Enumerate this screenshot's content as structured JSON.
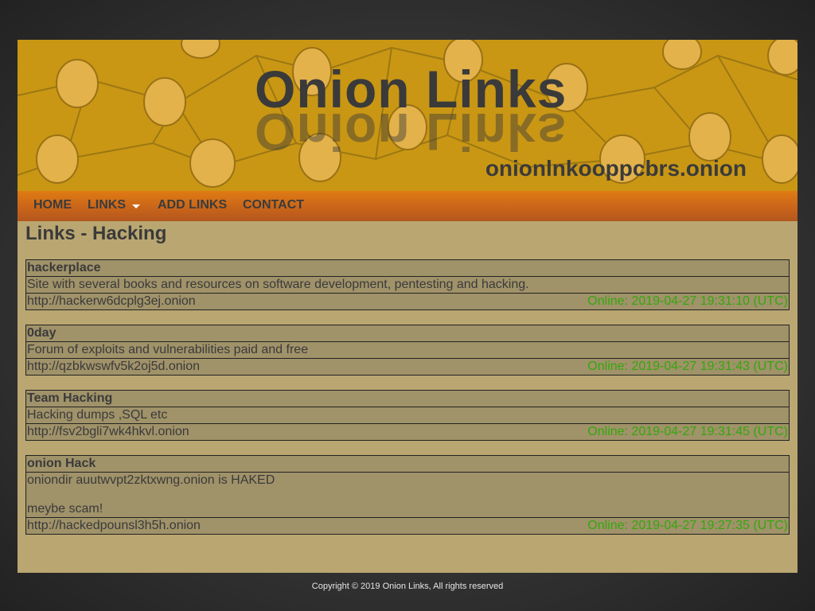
{
  "banner": {
    "title": "Onion Links",
    "domain": "onionlnkooppcbrs.onion"
  },
  "nav": {
    "home": "HOME",
    "links": "LINKS",
    "add_links": "ADD LINKS",
    "contact": "CONTACT"
  },
  "page_heading": "Links - Hacking",
  "entries": [
    {
      "title": "hackerplace",
      "description": "Site with several books and resources on software development, pentesting and hacking.",
      "url": "http://hackerw6dcplg3ej.onion",
      "status": "Online: 2019-04-27 19:31:10 (UTC)"
    },
    {
      "title": "0day",
      "description": "Forum of exploits and vulnerabilities paid and free",
      "url": "http://qzbkwswfv5k2oj5d.onion",
      "status": "Online: 2019-04-27 19:31:43 (UTC)"
    },
    {
      "title": "Team Hacking",
      "description": "Hacking dumps ,SQL etc",
      "url": "http://fsv2bgli7wk4hkvl.onion",
      "status": "Online: 2019-04-27 19:31:45 (UTC)"
    },
    {
      "title": "onion Hack",
      "description": "oniondir auutwvpt2zktxwng.onion is HAKED",
      "description_line2": "meybe scam!",
      "url": "http://hackedpounsl3h5h.onion",
      "status": "Online: 2019-04-27 19:27:35 (UTC)"
    }
  ],
  "footer": "Copyright © 2019 Onion Links, All rights reserved",
  "colors": {
    "banner": "#c99714",
    "nav_orange": "#d56f16",
    "content_bg": "#b9a671",
    "entry_bg": "#a09269",
    "online_green": "#33a80c"
  }
}
